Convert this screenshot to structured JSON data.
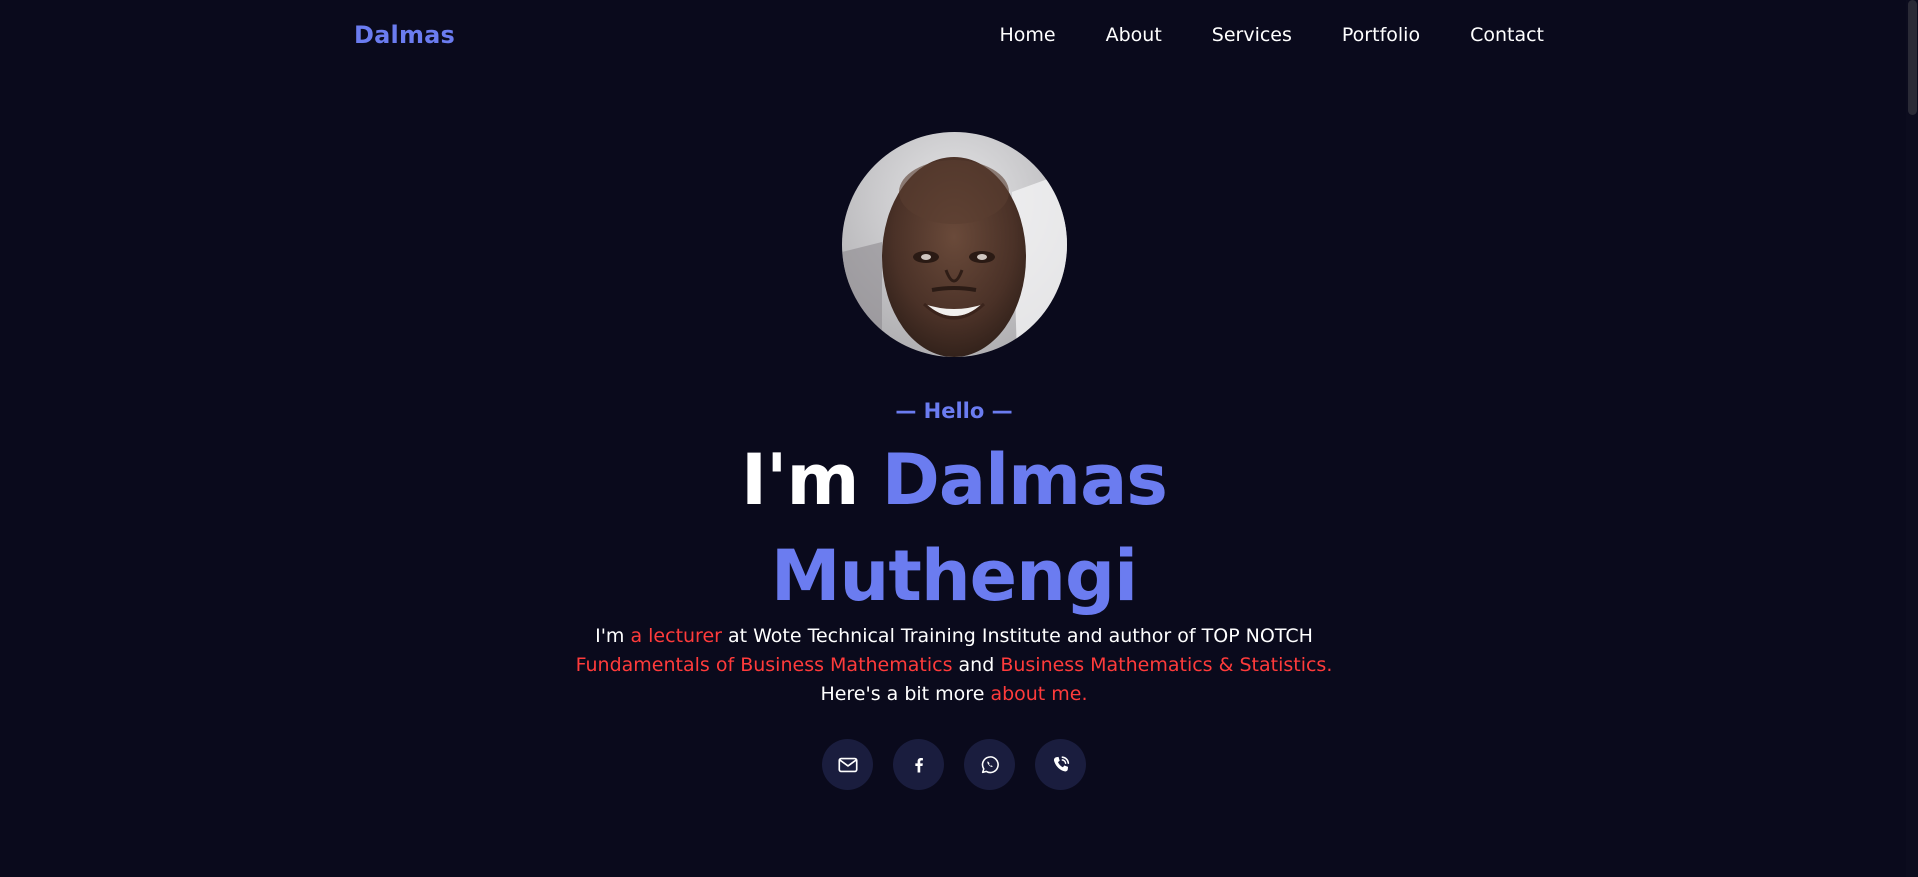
{
  "nav": {
    "brand": "Dalmas",
    "items": [
      {
        "label": "Home"
      },
      {
        "label": "About"
      },
      {
        "label": "Services"
      },
      {
        "label": "Portfolio"
      },
      {
        "label": "Contact"
      }
    ]
  },
  "hero": {
    "hello": "— Hello —",
    "title_prefix": "I'm ",
    "title_first": "Dalmas",
    "title_last": "Muthengi",
    "desc": {
      "part1": "I'm ",
      "lecturer": "a lecturer",
      "part2": " at Wote Technical Training Institute and author of TOP NOTCH",
      "book1": "Fundamentals of Business Mathematics",
      "and": " and ",
      "book2": "Business Mathematics & Statistics.",
      "part3": "Here's a bit more ",
      "about_link": "about me."
    }
  },
  "socials": [
    {
      "icon": "mail-icon"
    },
    {
      "icon": "facebook-icon"
    },
    {
      "icon": "whatsapp-icon"
    },
    {
      "icon": "phone-icon"
    }
  ],
  "colors": {
    "background": "#0a0a1c",
    "accent": "#6b7cf0",
    "highlight": "#ff3b3b",
    "social_bg": "#1a1d3e"
  }
}
